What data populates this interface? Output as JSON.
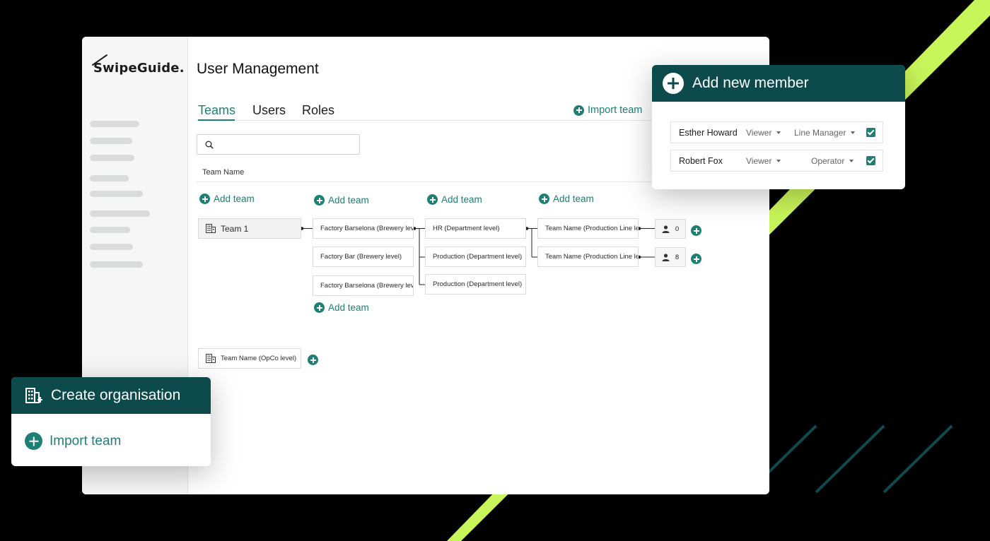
{
  "colors": {
    "accent": "#1f7f74",
    "header": "#0d4a4b",
    "stripe": "#c8f55a"
  },
  "sidebar": {
    "logo": "SwipeGuide."
  },
  "page": {
    "title": "User Management"
  },
  "tabs": [
    {
      "label": "Teams"
    },
    {
      "label": "Users"
    },
    {
      "label": "Roles"
    }
  ],
  "toolbar": {
    "import_label": "Import team"
  },
  "search": {
    "placeholder": "",
    "value": ""
  },
  "table": {
    "column_header": "Team Name"
  },
  "tree": {
    "add_team_label": "Add team",
    "root": "Team 1",
    "level2": [
      "Factory Barselona (Brewery level)",
      "Factory Bar (Brewery level)",
      "Factory Barselona (Brewery level)"
    ],
    "level3": [
      "HR (Department level)",
      "Production (Department level)",
      "Production (Department level)"
    ],
    "level4": [
      "Team Name (Production Line level)",
      "Team Name (Production Line level)"
    ],
    "user_counts": [
      "0",
      "8"
    ],
    "opco": "Team Name (OpCo level)"
  },
  "member_card": {
    "title": "Add new member",
    "members": [
      {
        "name": "Esther Howard",
        "permission": "Viewer",
        "role": "Line Manager",
        "checked": true
      },
      {
        "name": "Robert Fox",
        "permission": "Viewer",
        "role": "Operator",
        "checked": true
      }
    ]
  },
  "org_card": {
    "title": "Create organisation",
    "import_label": "Import team"
  }
}
